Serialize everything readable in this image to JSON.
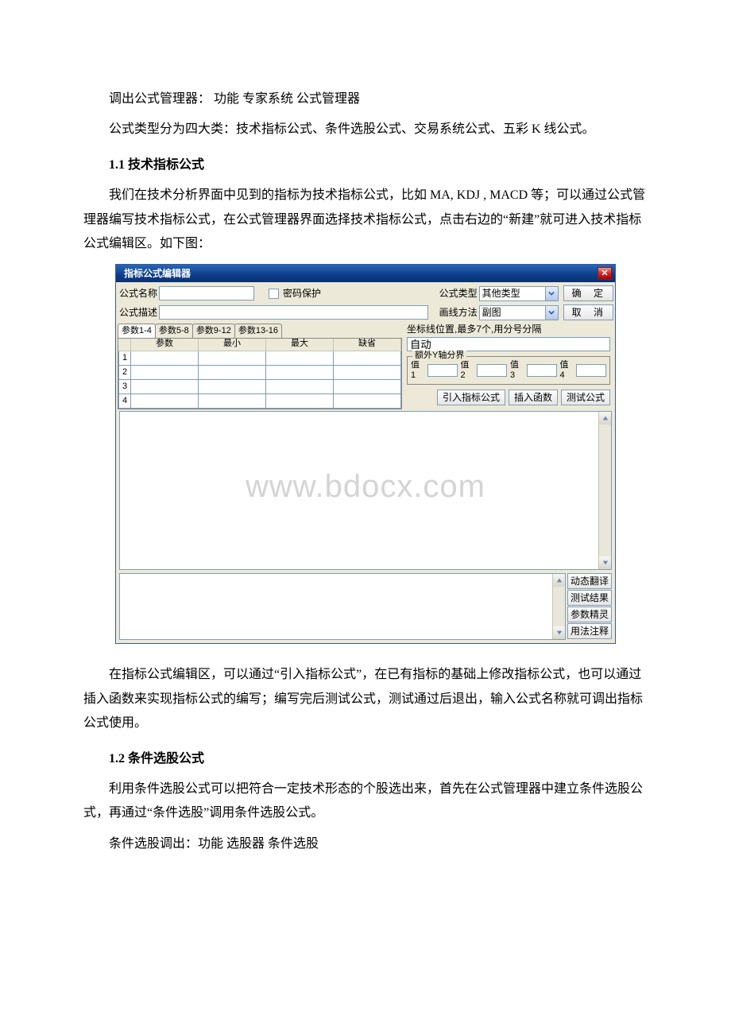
{
  "text": {
    "p1": "调出公式管理器： 功能 专家系统 公式管理器",
    "p2": "公式类型分为四大类：技术指标公式、条件选股公式、交易系统公式、五彩 K 线公式。",
    "h1": "1.1 技术指标公式",
    "p3": "我们在技术分析界面中见到的指标为技术指标公式，比如 MA, KDJ , MACD 等；可以通过公式管理器编写技术指标公式，在公式管理器界面选择技术指标公式，点击右边的“新建”就可进入技术指标公式编辑区。如下图：",
    "p4": "在指标公式编辑区，可以通过“引入指标公式”，在已有指标的基础上修改指标公式，也可以通过插入函数来实现指标公式的编写；编写完后测试公式，测试通过后退出，输入公式名称就可调出指标公式使用。",
    "h2": "1.2 条件选股公式",
    "p5": "利用条件选股公式可以把符合一定技术形态的个股选出来，首先在公式管理器中建立条件选股公式，再通过“条件选股”调用条件选股公式。",
    "p6": "条件选股调出：功能 选股器 条件选股"
  },
  "dialog": {
    "title": "指标公式编辑器",
    "labels": {
      "name": "公式名称",
      "pwd": "密码保护",
      "type": "公式类型",
      "desc": "公式描述",
      "drawMethod": "画线方法",
      "coord": "坐标线位置,最多7个,用分号分隔",
      "coordValue": "自动",
      "yfield": "额外Y轴分界",
      "v1": "值1",
      "v2": "值2",
      "v3": "值3",
      "v4": "值4"
    },
    "typeValue": "其他类型",
    "drawValue": "副图",
    "paramTabs": [
      "参数1-4",
      "参数5-8",
      "参数9-12",
      "参数13-16"
    ],
    "paramHead": [
      "参数",
      "最小",
      "最大",
      "缺省"
    ],
    "paramRows": [
      "1",
      "2",
      "3",
      "4"
    ],
    "buttons": {
      "ok": "确  定",
      "cancel": "取  消",
      "import": "引入指标公式",
      "insertFn": "插入函数",
      "test": "测试公式",
      "dynTrans": "动态翻译",
      "testResult": "测试结果",
      "paramWizard": "参数精灵",
      "usage": "用法注释"
    },
    "watermark": "www.bdocx.com"
  }
}
